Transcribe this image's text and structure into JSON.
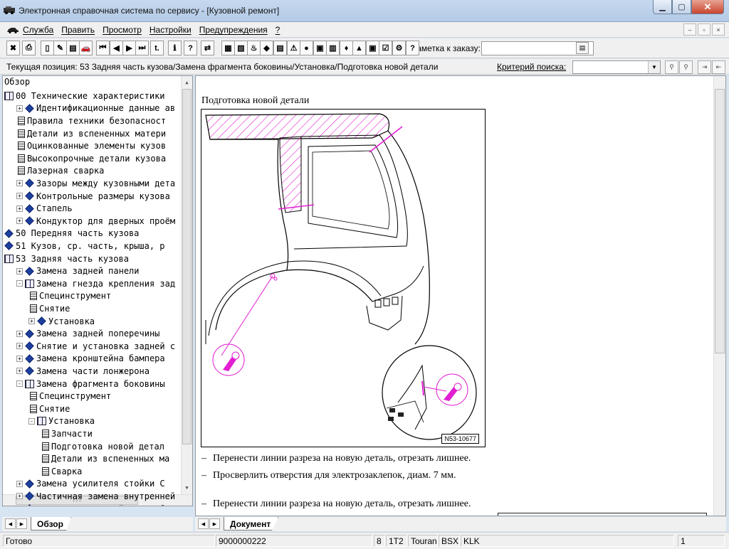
{
  "window": {
    "title": "Электронная справочная система по сервису - [Кузовной ремонт]",
    "minimize": "▁",
    "restore": "▢",
    "close": "✕"
  },
  "menu": [
    "Служба",
    "Править",
    "Просмотр",
    "Настройки",
    "Предупреждения",
    "?"
  ],
  "mdi_buttons": [
    "–",
    "▫",
    "×"
  ],
  "toolbar": {
    "order_label": "Заметка к заказу:",
    "order_value": "",
    "buttons": [
      "✖",
      "⎙",
      "▯",
      "✎",
      "▤",
      "🚗",
      "⏮",
      "◀",
      "▶",
      "⏭",
      "t.",
      "ℹ",
      "?",
      "⇄",
      "▦",
      "▧",
      "♨",
      "◆",
      "▤",
      "⚠",
      "●",
      "▣",
      "▥",
      "♦",
      "▲",
      "▣",
      "☑",
      "⚙",
      "?"
    ]
  },
  "position_bar": {
    "current_label": "Текущая позиция: 53 Задняя часть кузова/Замена фрагмента боковины/Установка/Подготовка новой детали",
    "criteria_label": "Критерий поиска:",
    "criteria_value": ""
  },
  "tree": {
    "header": "Обзор",
    "rows": [
      {
        "label": "00 Технические характеристики",
        "icon": "book",
        "indent": 0,
        "toggle": ""
      },
      {
        "label": "Идентификационные данные ав",
        "icon": "diamond",
        "indent": 1,
        "toggle": "+"
      },
      {
        "label": "Правила техники безопасност",
        "icon": "page",
        "indent": 1,
        "toggle": ""
      },
      {
        "label": "Детали из вспененных матери",
        "icon": "page",
        "indent": 1,
        "toggle": ""
      },
      {
        "label": "Оцинкованные элементы кузов",
        "icon": "page",
        "indent": 1,
        "toggle": ""
      },
      {
        "label": "Высокопрочные детали кузова",
        "icon": "page",
        "indent": 1,
        "toggle": ""
      },
      {
        "label": "Лазерная сварка",
        "icon": "page",
        "indent": 1,
        "toggle": ""
      },
      {
        "label": "Зазоры между кузовными дета",
        "icon": "diamond",
        "indent": 1,
        "toggle": "+"
      },
      {
        "label": "Контрольные размеры кузова",
        "icon": "diamond",
        "indent": 1,
        "toggle": "+"
      },
      {
        "label": "Стапель",
        "icon": "diamond",
        "indent": 1,
        "toggle": "+"
      },
      {
        "label": "Кондуктор для дверных проём",
        "icon": "diamond",
        "indent": 1,
        "toggle": "+"
      },
      {
        "label": "50 Передняя часть кузова",
        "icon": "diamond",
        "indent": 0,
        "toggle": ""
      },
      {
        "label": "51 Кузов, ср. часть, крыша, р",
        "icon": "diamond",
        "indent": 0,
        "toggle": ""
      },
      {
        "label": "53 Задняя часть кузова",
        "icon": "book",
        "indent": 0,
        "toggle": ""
      },
      {
        "label": "Замена задней панели",
        "icon": "diamond",
        "indent": 1,
        "toggle": "+"
      },
      {
        "label": "Замена гнезда крепления зад",
        "icon": "book",
        "indent": 1,
        "toggle": "-"
      },
      {
        "label": "Специнструмент",
        "icon": "page",
        "indent": 2,
        "toggle": ""
      },
      {
        "label": "Снятие",
        "icon": "page",
        "indent": 2,
        "toggle": ""
      },
      {
        "label": "Установка",
        "icon": "diamond",
        "indent": 2,
        "toggle": "+"
      },
      {
        "label": "Замена задней поперечины",
        "icon": "diamond",
        "indent": 1,
        "toggle": "+"
      },
      {
        "label": "Снятие и установка задней с",
        "icon": "diamond",
        "indent": 1,
        "toggle": "+"
      },
      {
        "label": "Замена кронштейна бампера",
        "icon": "diamond",
        "indent": 1,
        "toggle": "+"
      },
      {
        "label": "Замена части лонжерона",
        "icon": "diamond",
        "indent": 1,
        "toggle": "+"
      },
      {
        "label": "Замена фрагмента боковины",
        "icon": "book",
        "indent": 1,
        "toggle": "-"
      },
      {
        "label": "Специнструмент",
        "icon": "page",
        "indent": 2,
        "toggle": ""
      },
      {
        "label": "Снятие",
        "icon": "page",
        "indent": 2,
        "toggle": ""
      },
      {
        "label": "Установка",
        "icon": "book",
        "indent": 2,
        "toggle": "-"
      },
      {
        "label": "Запчасти",
        "icon": "page",
        "indent": 3,
        "toggle": ""
      },
      {
        "label": "Подготовка новой детал",
        "icon": "page",
        "indent": 3,
        "toggle": ""
      },
      {
        "label": "Детали из вспененных ма",
        "icon": "page",
        "indent": 3,
        "toggle": ""
      },
      {
        "label": "Сварка",
        "icon": "page",
        "indent": 3,
        "toggle": ""
      },
      {
        "label": "Замена усилителя стойки С",
        "icon": "diamond",
        "indent": 1,
        "toggle": "+"
      },
      {
        "label": "Частичная замена внутренней",
        "icon": "diamond",
        "indent": 1,
        "toggle": "+"
      },
      {
        "label": "Замена внутренней части бо",
        "icon": "diamond",
        "indent": 1,
        "toggle": "+"
      }
    ]
  },
  "tabs": {
    "left": "Обзор",
    "right": "Документ"
  },
  "document": {
    "heading": "Подготовка новой детали",
    "figure_id": "N53-10677",
    "steps": [
      "Перенести линии разреза на новую деталь, отрезать лишнее.",
      "Просверлить отверстия для электрозаклепок, диам. 7 мм.",
      "Перенести линии разреза на новую деталь, отрезать лишнее."
    ],
    "step_marker": "–"
  },
  "status": {
    "ready": "Готово",
    "code": "9000000222",
    "num": "8",
    "model_code": "1T2",
    "model": "Touran",
    "bsx": "BSX",
    "klk": "KLK",
    "page": "1"
  },
  "colors": {
    "accent": "#e21fd1",
    "tree_icon": "#1c3f9e"
  }
}
